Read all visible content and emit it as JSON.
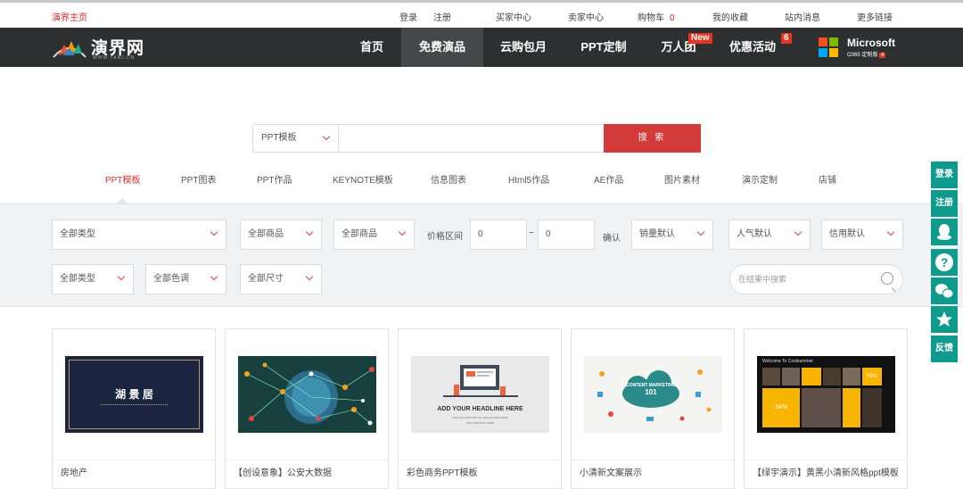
{
  "topbar": {
    "home": "演界主页",
    "links": [
      "登录",
      "注册",
      "买家中心",
      "卖家中心",
      "购物车",
      "我的收藏",
      "站内消息",
      "更多链接"
    ],
    "cart_count": "0"
  },
  "logo": {
    "text": "演界网",
    "sub": "WWW.YANJ.CN"
  },
  "nav": {
    "items": [
      {
        "label": "首页"
      },
      {
        "label": "免费演品"
      },
      {
        "label": "云购包月"
      },
      {
        "label": "PPT定制"
      },
      {
        "label": "万人团",
        "badge": "New"
      },
      {
        "label": "优惠活动",
        "badge": "6"
      }
    ],
    "microsoft": {
      "title": "Microsoft",
      "sub": "O365 定制版",
      "badge": "4"
    }
  },
  "search": {
    "type": "PPT模板",
    "button": "搜 索"
  },
  "categories": [
    "PPT模板",
    "PPT图表",
    "PPT作品",
    "KEYNOTE模板",
    "信息图表",
    "Html5作品",
    "AE作品",
    "图片素材",
    "演示定制",
    "店铺"
  ],
  "filters": {
    "row1": [
      "全部类型",
      "全部商品",
      "全部商品"
    ],
    "price_label": "价格区间",
    "price_from": "0",
    "price_sep": "~",
    "price_to": "0",
    "confirm": "确认",
    "sorts": [
      "销量默认",
      "人气默认",
      "信用默认"
    ],
    "row2": [
      "全部类型",
      "全部色调",
      "全部尺寸"
    ],
    "search_placeholder": "在结果中搜索"
  },
  "products": [
    {
      "title": "房地产",
      "thumb_text": "湖 景 居"
    },
    {
      "title": "【创设意象】公安大数据"
    },
    {
      "title": "彩色商务PPT模板",
      "thumb_text": "ADD YOUR HEADLINE HERE",
      "thumb_sub": "ADD INFORMATION OF THE AUTHOR HERE",
      "thumb_sub2": "ADD THE DATE HERE"
    },
    {
      "title": "小清新文案展示",
      "thumb_text": "CONTENT MARKETING",
      "thumb_num": "101"
    },
    {
      "title": "【绿宇演示】黄黑小清新风格ppt模板",
      "thumb_text": "Welcome To Coolsummer",
      "thumb_pct1": "59%",
      "thumb_pct2": "34%"
    }
  ],
  "sidebar": {
    "login": "登录",
    "register": "注册",
    "feedback": "反馈"
  },
  "colors": {
    "accent": "#d33a3a",
    "nav_bg": "#2e2f30",
    "side": "#0e9a8c"
  }
}
